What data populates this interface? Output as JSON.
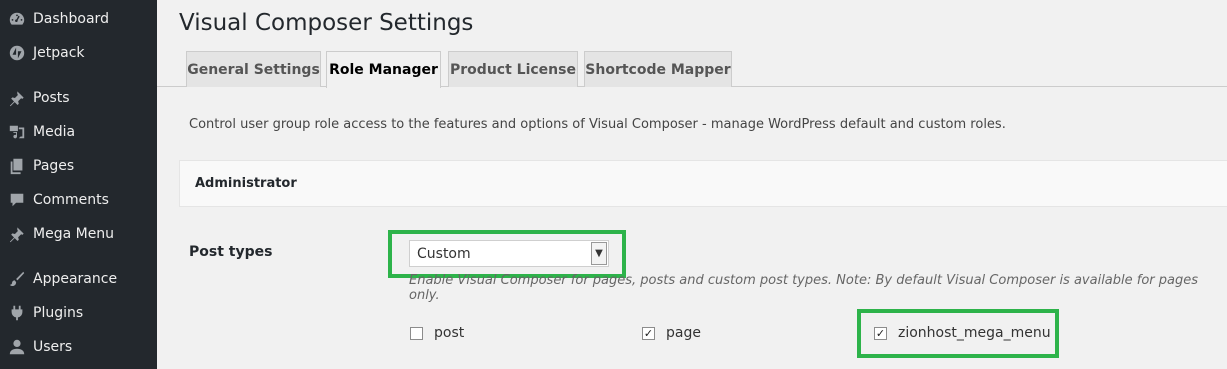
{
  "sidebar": {
    "items": [
      {
        "label": "Dashboard",
        "icon": "dashboard-icon"
      },
      {
        "label": "Jetpack",
        "icon": "jetpack-icon"
      },
      {
        "label": "Posts",
        "icon": "pin-icon"
      },
      {
        "label": "Media",
        "icon": "media-icon"
      },
      {
        "label": "Pages",
        "icon": "pages-icon"
      },
      {
        "label": "Comments",
        "icon": "comment-icon"
      },
      {
        "label": "Mega Menu",
        "icon": "pin-icon"
      },
      {
        "label": "Appearance",
        "icon": "brush-icon"
      },
      {
        "label": "Plugins",
        "icon": "plug-icon"
      },
      {
        "label": "Users",
        "icon": "user-icon"
      }
    ]
  },
  "page": {
    "title": "Visual Composer Settings"
  },
  "tabs": [
    {
      "label": "General Settings",
      "active": false
    },
    {
      "label": "Role Manager",
      "active": true
    },
    {
      "label": "Product License",
      "active": false
    },
    {
      "label": "Shortcode Mapper",
      "active": false
    }
  ],
  "description": "Control user group role access to the features and options of Visual Composer - manage WordPress default and custom roles.",
  "role": {
    "name": "Administrator"
  },
  "post_types": {
    "label": "Post types",
    "selected": "Custom",
    "note": "Enable Visual Composer for pages, posts and custom post types. Note: By default Visual Composer is available for pages only.",
    "options": [
      {
        "label": "post",
        "checked": false
      },
      {
        "label": "page",
        "checked": true
      },
      {
        "label": "zionhost_mega_menu",
        "checked": true
      }
    ]
  },
  "colors": {
    "sidebar_bg": "#23282d",
    "highlight": "#2db34a",
    "background": "#f1f1f1"
  }
}
